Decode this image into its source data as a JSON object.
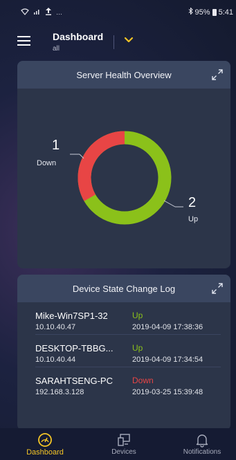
{
  "status_bar": {
    "battery": "95%",
    "time": "5:41"
  },
  "app_bar": {
    "title": "Dashboard",
    "subtitle": "all"
  },
  "health_card": {
    "title": "Server Health Overview",
    "down": {
      "count": "1",
      "label": "Down",
      "color": "#e84545"
    },
    "up": {
      "count": "2",
      "label": "Up",
      "color": "#8bc11a"
    }
  },
  "log_card": {
    "title": "Device State Change Log",
    "rows": [
      {
        "name": "Mike-Win7SP1-32",
        "ip": "10.10.40.47",
        "state": "Up",
        "time": "2019-04-09 17:38:36"
      },
      {
        "name": "DESKTOP-TBBG...",
        "ip": "10.10.40.44",
        "state": "Up",
        "time": "2019-04-09 17:34:54"
      },
      {
        "name": "SARAHTSENG-PC",
        "ip": "192.168.3.128",
        "state": "Down",
        "time": "2019-03-25 15:39:48"
      }
    ]
  },
  "bottom_nav": {
    "dashboard": "Dashboard",
    "devices": "Devices",
    "notifications": "Notifications"
  },
  "colors": {
    "accent": "#f4c526",
    "up": "#8bc11a",
    "down": "#e84545"
  }
}
